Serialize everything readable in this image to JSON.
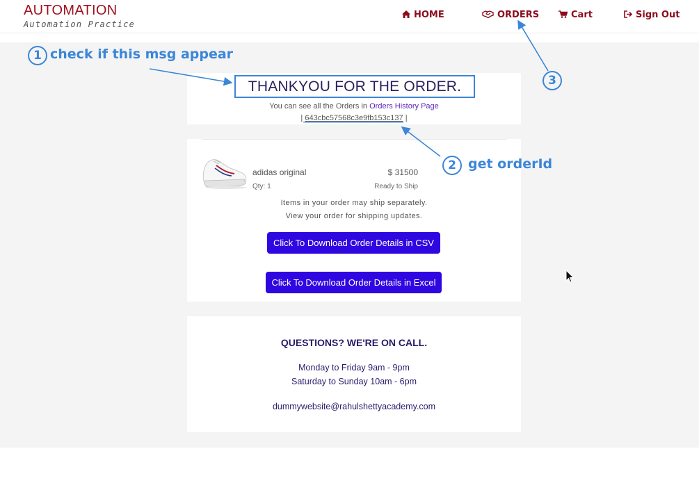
{
  "header": {
    "brand_name": "AUTOMATION",
    "brand_tagline": "Automation Practice",
    "nav": {
      "home": "HOME",
      "orders": "ORDERS",
      "cart": "Cart",
      "signout": "Sign Out"
    }
  },
  "thanks": {
    "title": "THANKYOU FOR THE ORDER.",
    "history_prefix": "You can see all the Orders in",
    "history_link": "Orders History Page",
    "order_id_left": "|",
    "order_id": "643cbc57568c3e9fb153c137",
    "order_id_right": "|"
  },
  "order_item": {
    "name": "adidas original",
    "price": "$ 31500",
    "qty": "Qty: 1",
    "status": "Ready to Ship",
    "note_line1": "Items in your order may ship separately.",
    "note_line2": "View your order for shipping updates."
  },
  "buttons": {
    "csv": "Click To Download Order Details in CSV",
    "excel": "Click To Download Order Details in Excel"
  },
  "help": {
    "title": "QUESTIONS? WE'RE ON CALL.",
    "weekday": "Monday to Friday 9am - 9pm",
    "weekend": "Saturday to Sunday 10am - 6pm",
    "email": "dummywebsite@rahulshettyacademy.com"
  },
  "annotations": {
    "n1": "1",
    "t1": "check if this msg appear",
    "n2": "2",
    "t2": "get orderId",
    "n3": "3"
  },
  "colors": {
    "brand": "#a0101e",
    "nav": "#8b0d1c",
    "button": "#2f07e0",
    "annotation": "#3b86d8",
    "heading": "#2b1a6a"
  },
  "icons": {
    "home": "home-icon",
    "orders": "handshake-icon",
    "cart": "cart-icon",
    "signout": "sign-out-icon"
  }
}
